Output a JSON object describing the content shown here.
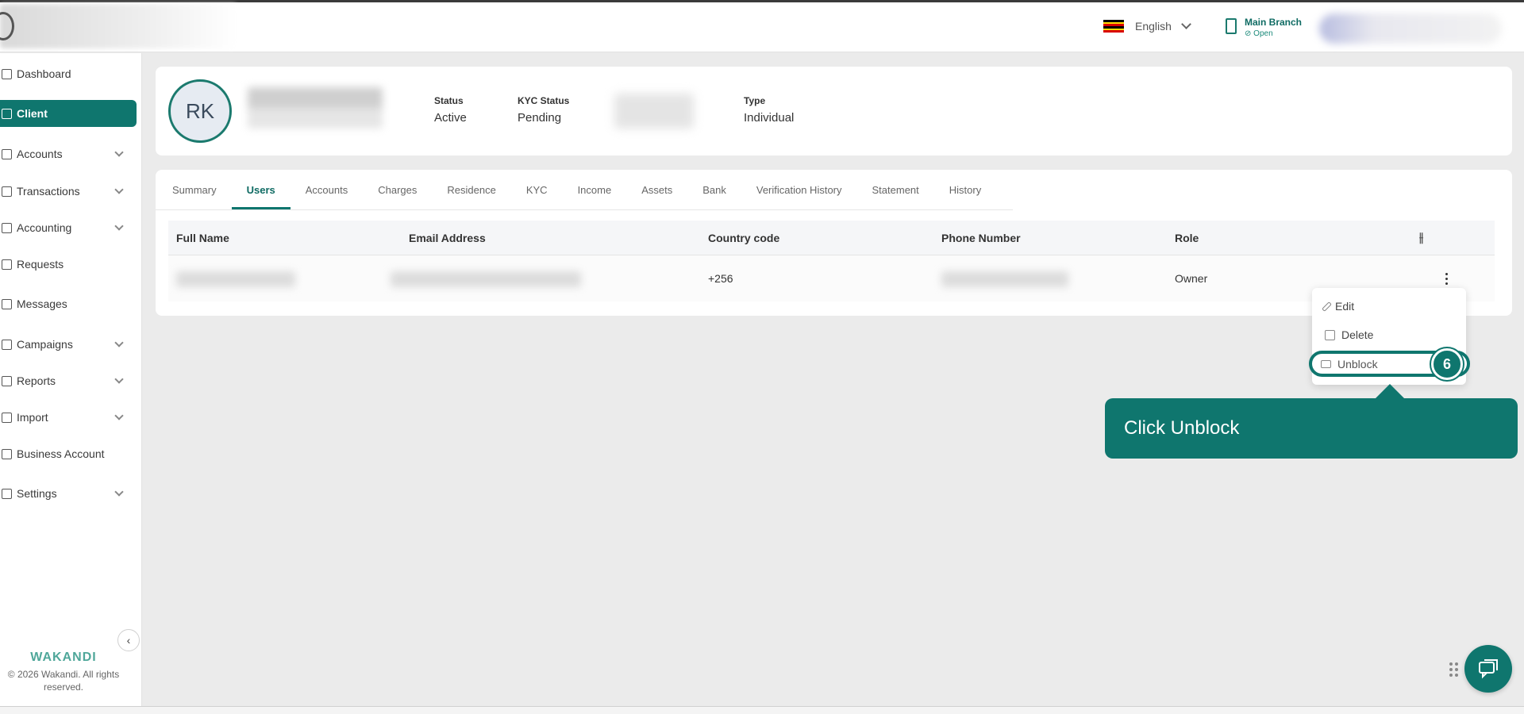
{
  "header": {
    "language": "English",
    "branch_name": "Main Branch",
    "branch_status": "Open"
  },
  "sidebar": {
    "items": [
      {
        "label": "Dashboard",
        "icon": "home-icon"
      },
      {
        "label": "Client",
        "icon": "users-icon",
        "active": true
      },
      {
        "label": "Accounts",
        "icon": "bank-icon"
      },
      {
        "label": "Transactions",
        "icon": "transactions-icon"
      },
      {
        "label": "Accounting",
        "icon": "ledger-icon"
      },
      {
        "label": "Requests",
        "icon": "requests-icon"
      },
      {
        "label": "Messages",
        "icon": "message-icon"
      },
      {
        "label": "Campaigns",
        "icon": "grid-icon"
      },
      {
        "label": "Reports",
        "icon": "chart-icon"
      },
      {
        "label": "Import",
        "icon": "upload-icon"
      },
      {
        "label": "Business Account",
        "icon": "briefcase-icon"
      },
      {
        "label": "Settings",
        "icon": "gear-icon"
      }
    ],
    "brand": "WAKANDI",
    "copyright": "© 2026 Wakandi. All rights reserved."
  },
  "client": {
    "initials": "RK",
    "status_label": "Status",
    "status_value": "Active",
    "kyc_label": "KYC Status",
    "kyc_value": "Pending",
    "type_label": "Type",
    "type_value": "Individual"
  },
  "tabs": [
    "Summary",
    "Users",
    "Accounts",
    "Charges",
    "Residence",
    "KYC",
    "Income",
    "Assets",
    "Bank",
    "Verification History",
    "Statement",
    "History"
  ],
  "table": {
    "columns": [
      "Full Name",
      "Email Address",
      "Country code",
      "Phone Number",
      "Role"
    ],
    "rows": [
      {
        "country_code": "+256",
        "role": "Owner"
      }
    ]
  },
  "row_menu": {
    "edit": "Edit",
    "delete": "Delete",
    "unblock": "Unblock"
  },
  "guide": {
    "step": "6",
    "tooltip": "Click Unblock"
  },
  "colors": {
    "accent": "#0f766e",
    "background": "#ebebeb"
  }
}
